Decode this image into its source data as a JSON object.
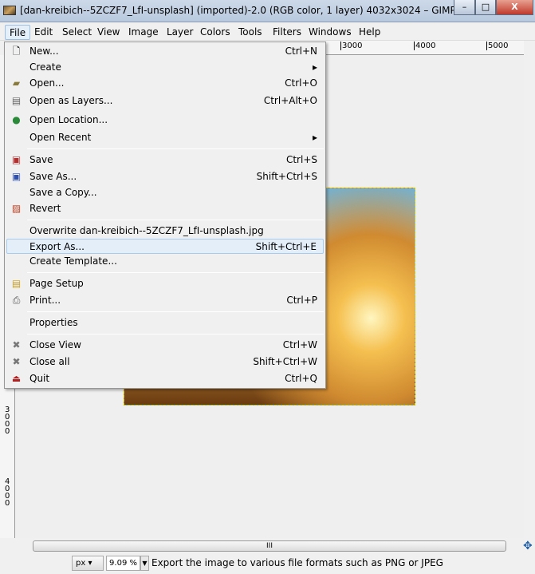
{
  "window": {
    "title": "[dan-kreibich--5ZCZF7_LfI-unsplash] (imported)-2.0 (RGB color, 1 layer) 4032x3024 – GIMP",
    "minimize": "–",
    "maximize": "□",
    "close": "X"
  },
  "menubar": [
    "File",
    "Edit",
    "Select",
    "View",
    "Image",
    "Layer",
    "Colors",
    "Tools",
    "Filters",
    "Windows",
    "Help"
  ],
  "ruler": {
    "h": [
      "3000",
      "4000",
      "5000"
    ],
    "v": [
      "3000",
      "4000"
    ]
  },
  "file_menu": [
    {
      "label": "New...",
      "shortcut": "Ctrl+N",
      "icon": "new-file-icon"
    },
    {
      "label": "Create",
      "shortcut": "▸"
    },
    {
      "label": "Open...",
      "shortcut": "Ctrl+O",
      "icon": "folder-open-icon"
    },
    {
      "label": "Open as Layers...",
      "shortcut": "Ctrl+Alt+O",
      "icon": "layers-icon"
    },
    {
      "label": "Open Location...",
      "shortcut": "",
      "icon": "globe-icon"
    },
    {
      "label": "Open Recent",
      "shortcut": "▸"
    },
    {
      "label": "Save",
      "shortcut": "Ctrl+S",
      "icon": "save-icon"
    },
    {
      "label": "Save As...",
      "shortcut": "Shift+Ctrl+S",
      "icon": "save-as-icon"
    },
    {
      "label": "Save a Copy...",
      "shortcut": ""
    },
    {
      "label": "Revert",
      "shortcut": "",
      "icon": "revert-icon"
    },
    {
      "label": "Overwrite dan-kreibich--5ZCZF7_LfI-unsplash.jpg",
      "shortcut": ""
    },
    {
      "label": "Export As...",
      "shortcut": "Shift+Ctrl+E"
    },
    {
      "label": "Create Template...",
      "shortcut": ""
    },
    {
      "label": "Page Setup",
      "shortcut": "",
      "icon": "page-setup-icon"
    },
    {
      "label": "Print...",
      "shortcut": "Ctrl+P",
      "icon": "printer-icon"
    },
    {
      "label": "Properties",
      "shortcut": ""
    },
    {
      "label": "Close View",
      "shortcut": "Ctrl+W",
      "icon": "close-icon"
    },
    {
      "label": "Close all",
      "shortcut": "Shift+Ctrl+W",
      "icon": "close-all-icon"
    },
    {
      "label": "Quit",
      "shortcut": "Ctrl+Q",
      "icon": "quit-icon"
    }
  ],
  "status": {
    "unit": "px",
    "zoom": "9.09 %",
    "message": "Export the image to various file formats such as PNG or JPEG"
  },
  "scrollbar_grip": "III"
}
